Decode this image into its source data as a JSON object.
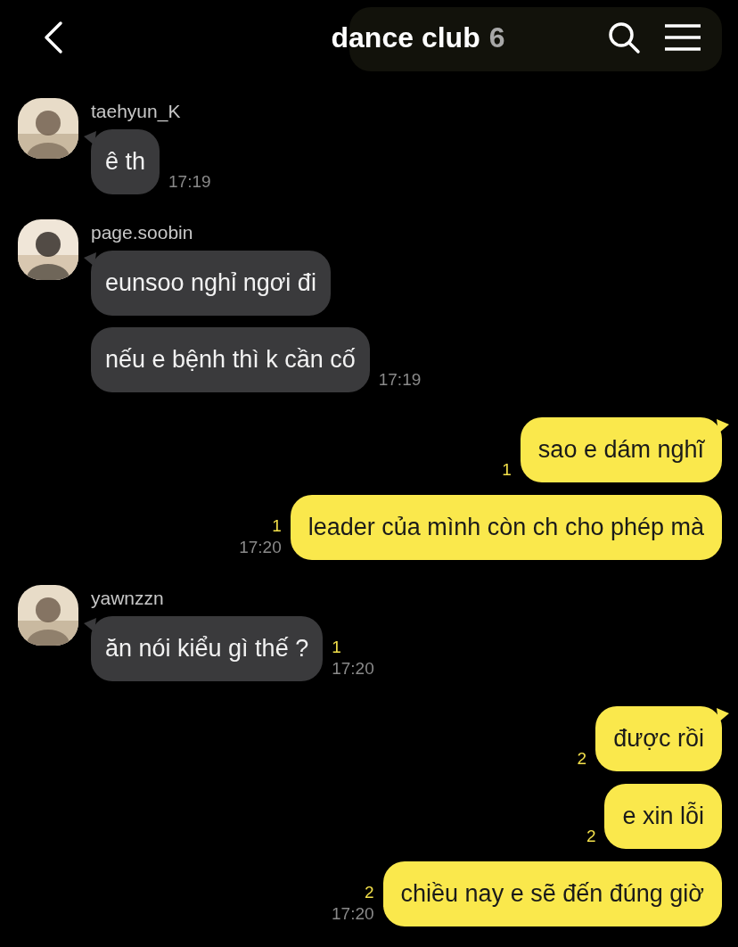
{
  "header": {
    "title": "dance club",
    "member_count": "6"
  },
  "groups": [
    {
      "kind": "incoming",
      "sender": "taehyun_K",
      "avatar": {
        "kind": "picture"
      },
      "bubbles": [
        {
          "text": "ê th",
          "time": "17:19"
        }
      ]
    },
    {
      "kind": "incoming",
      "sender": "page.soobin",
      "avatar": {
        "kind": "picture"
      },
      "bubbles": [
        {
          "text": "eunsoo nghỉ ngơi đi"
        },
        {
          "text": "nếu e bệnh thì k cần cố",
          "time": "17:19"
        }
      ]
    },
    {
      "kind": "outgoing",
      "bubbles": [
        {
          "text": "sao e dám nghĩ",
          "unread": "1"
        },
        {
          "text": "leader của mình còn ch cho phép mà",
          "unread": "1",
          "time": "17:20"
        }
      ]
    },
    {
      "kind": "incoming",
      "sender": "yawnzzn",
      "avatar": {
        "kind": "picture"
      },
      "bubbles": [
        {
          "text": "ăn nói kiểu gì thế ?",
          "unread": "1",
          "time": "17:20"
        }
      ]
    },
    {
      "kind": "outgoing",
      "bubbles": [
        {
          "text": "được rồi",
          "unread": "2"
        },
        {
          "text": "e xin lỗi",
          "unread": "2"
        },
        {
          "text": "chiều nay e sẽ đến đúng giờ",
          "unread": "2",
          "time": "17:20"
        }
      ]
    }
  ]
}
